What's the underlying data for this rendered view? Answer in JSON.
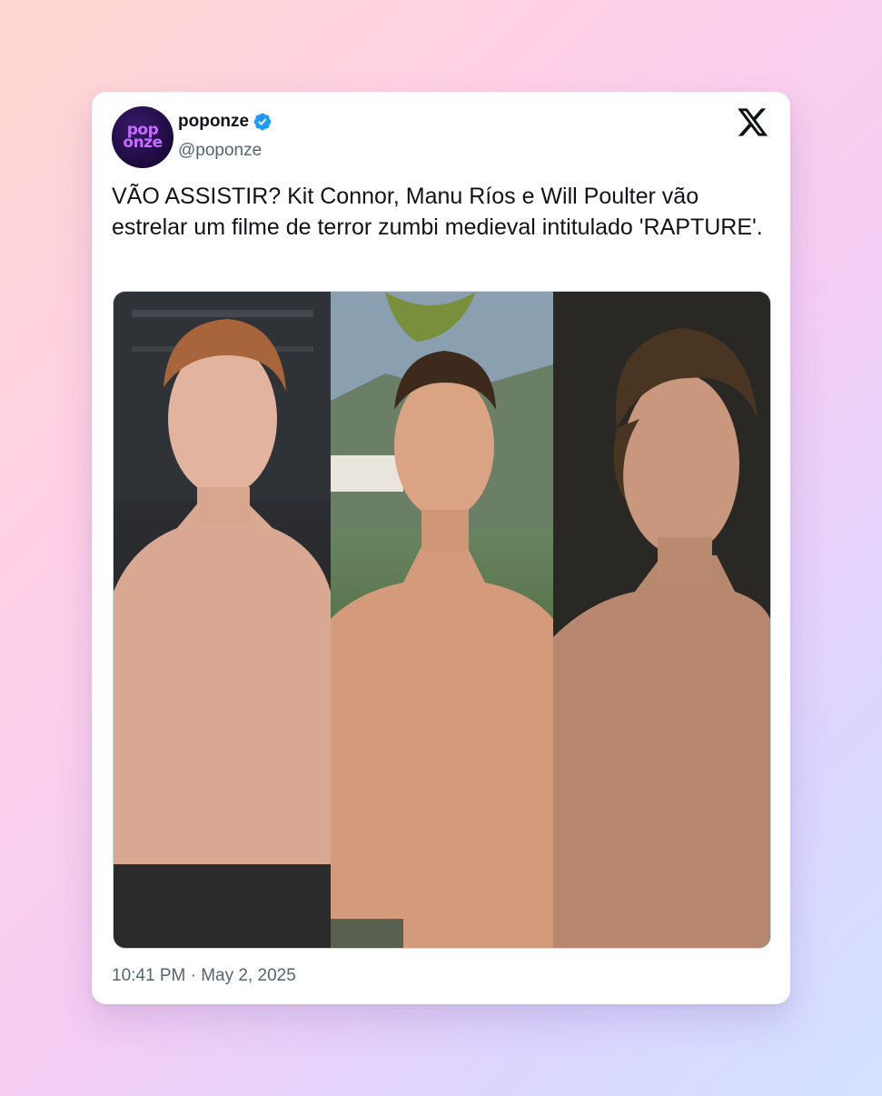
{
  "tweet": {
    "avatar_text_line1": "pop",
    "avatar_text_line2": "onze",
    "display_name": "poponze",
    "verified": true,
    "handle": "@poponze",
    "text": "VÃO ASSISTIR? Kit Connor, Manu Ríos e Will Poulter vão estrelar um filme de terror zumbi medieval intitulado 'RAPTURE'.",
    "timestamp": "10:41 PM · May 2, 2025",
    "platform_icon": "x-logo-icon",
    "media_panels": [
      "photo-panel-1",
      "photo-panel-2",
      "photo-panel-3"
    ]
  },
  "colors": {
    "accent_verified": "#1d9bf0",
    "text_primary": "#0f1419",
    "text_secondary": "#536471",
    "avatar_bg": "#1c0a3d",
    "avatar_text": "#c86bff"
  }
}
